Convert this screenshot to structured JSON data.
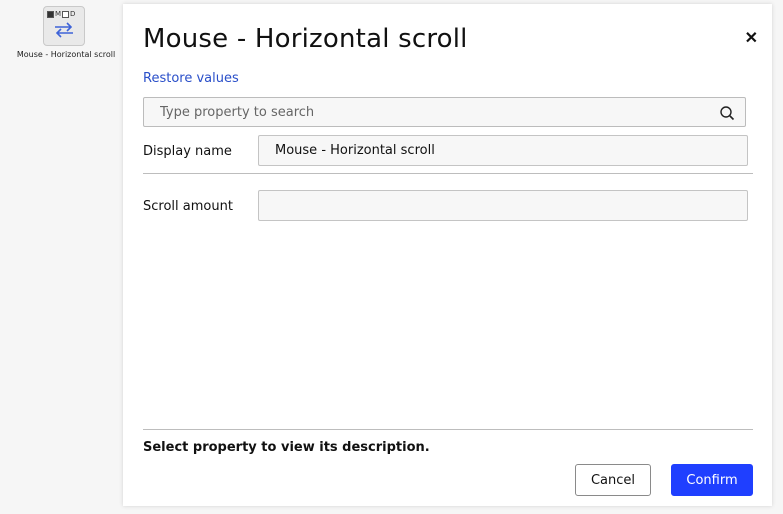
{
  "canvas_node": {
    "flag_m": "M",
    "flag_d": "D",
    "label": "Mouse - Horizontal scroll",
    "icon": "swap-arrows-icon"
  },
  "dialog": {
    "title": "Mouse - Horizontal scroll",
    "close_symbol": "✕",
    "restore_label": "Restore values",
    "search_placeholder": "Type property to search",
    "properties": [
      {
        "label": "Display name",
        "value": "Mouse - Horizontal scroll"
      },
      {
        "label": "Scroll amount",
        "value": ""
      }
    ],
    "description_hint": "Select property to view its description.",
    "cancel_label": "Cancel",
    "confirm_label": "Confirm"
  },
  "colors": {
    "link": "#2a4fc9",
    "primary": "#1f3fff",
    "background": "#f6f6f6"
  }
}
